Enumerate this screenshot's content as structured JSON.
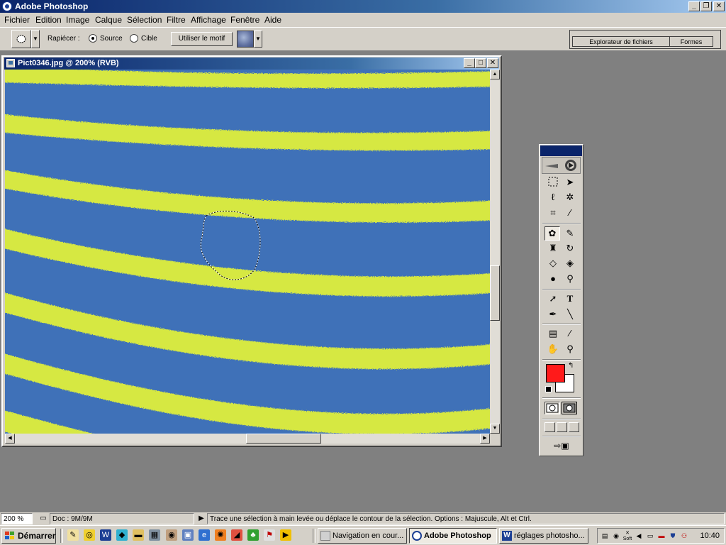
{
  "app": {
    "title": "Adobe Photoshop"
  },
  "menu": [
    "Fichier",
    "Edition",
    "Image",
    "Calque",
    "Sélection",
    "Filtre",
    "Affichage",
    "Fenêtre",
    "Aide"
  ],
  "options_bar": {
    "patch_label": "Rapiécer :",
    "source_label": "Source",
    "target_label": "Cible",
    "source_checked": true,
    "use_pattern_label": "Utiliser le motif"
  },
  "palette_well": {
    "tabs": [
      "Explorateur de fichiers",
      "Formes"
    ]
  },
  "document": {
    "title": "Pict0346.jpg @ 200% (RVB)",
    "stripe_colors": {
      "blue": "#3f71b8",
      "yellow": "#d6e842"
    }
  },
  "toolbox": {
    "foreground_color": "#ff1a1a",
    "background_color": "#ffffff",
    "tools": [
      "marquee-tool",
      "move-tool",
      "lasso-tool",
      "magic-wand-tool",
      "crop-tool",
      "slice-tool",
      "patch-tool",
      "brush-tool",
      "clone-stamp-tool",
      "history-brush-tool",
      "eraser-tool",
      "paint-bucket-tool",
      "blur-tool",
      "dodge-tool",
      "path-selection-tool",
      "type-tool",
      "pen-tool",
      "line-tool",
      "notes-tool",
      "eyedropper-tool",
      "hand-tool",
      "zoom-tool"
    ],
    "type_tool_glyph": "T"
  },
  "status": {
    "zoom": "200 %",
    "doc": "Doc : 9M/9M",
    "hint": "Trace une sélection à main levée ou déplace le contour de la sélection. Options : Majuscule, Alt et Ctrl."
  },
  "taskbar": {
    "start_label": "Démarrer",
    "tasks": [
      {
        "label": "Navigation en cour...",
        "active": false
      },
      {
        "label": "Adobe Photoshop",
        "active": true
      },
      {
        "label": "réglages photosho...",
        "active": false
      }
    ],
    "tray_soft_label": "Soft",
    "clock": "10:40"
  }
}
